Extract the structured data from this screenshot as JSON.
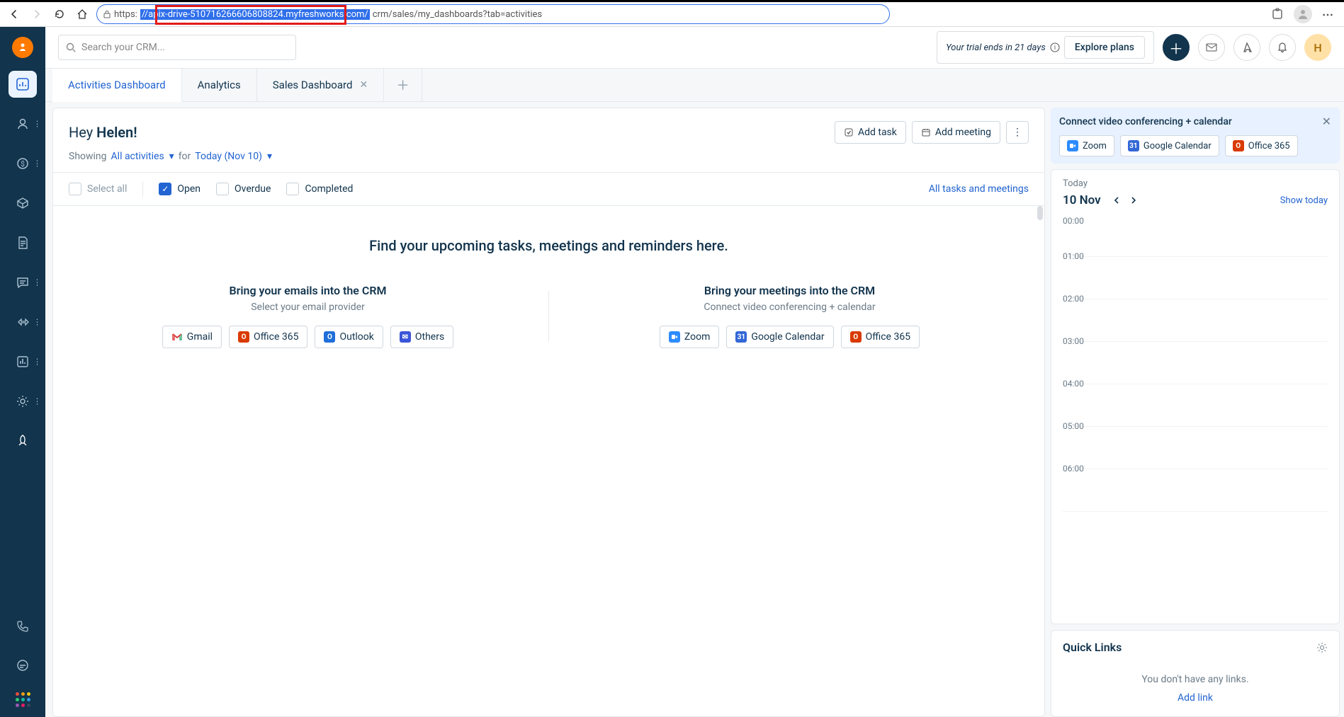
{
  "browser": {
    "url_prefix": "https:",
    "url_selected": "//apix-drive-510716266606808824.myfreshworks.com/",
    "url_suffix": "crm/sales/my_dashboards?tab=activities"
  },
  "search": {
    "placeholder": "Search your CRM..."
  },
  "topbar": {
    "trial_text": "Your trial ends in 21 days",
    "explore": "Explore plans",
    "user_initial": "H"
  },
  "tabs": [
    {
      "label": "Activities Dashboard",
      "active": true,
      "closable": false
    },
    {
      "label": "Analytics",
      "active": false,
      "closable": false
    },
    {
      "label": "Sales Dashboard",
      "active": false,
      "closable": true
    }
  ],
  "greeting": {
    "prefix": "Hey ",
    "name": "Helen!"
  },
  "actions": {
    "add_task": "Add task",
    "add_meeting": "Add meeting"
  },
  "filters": {
    "showing": "Showing",
    "all_activities": "All activities",
    "for": "for",
    "date": "Today (Nov 10)",
    "select_all": "Select all",
    "open": "Open",
    "overdue": "Overdue",
    "completed": "Completed",
    "all_link": "All tasks and meetings"
  },
  "empty": {
    "title": "Find your upcoming tasks, meetings and reminders here.",
    "emails": {
      "title": "Bring your emails into the CRM",
      "sub": "Select your email provider",
      "providers": [
        "Gmail",
        "Office 365",
        "Outlook",
        "Others"
      ]
    },
    "meetings": {
      "title": "Bring your meetings into the CRM",
      "sub": "Connect video conferencing + calendar",
      "providers": [
        "Zoom",
        "Google Calendar",
        "Office 365"
      ]
    }
  },
  "connect": {
    "title": "Connect video conferencing + calendar",
    "buttons": [
      "Zoom",
      "Google Calendar",
      "Office 365"
    ]
  },
  "calendar": {
    "today": "Today",
    "date": "10 Nov",
    "show_today": "Show today",
    "hours": [
      "00:00",
      "01:00",
      "02:00",
      "03:00",
      "04:00",
      "05:00",
      "06:00"
    ]
  },
  "quicklinks": {
    "title": "Quick Links",
    "empty": "You don't have any links.",
    "add": "Add link"
  }
}
